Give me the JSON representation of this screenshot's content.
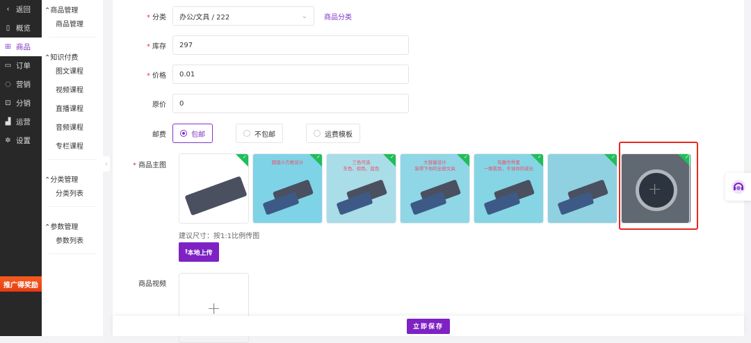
{
  "nav": [
    {
      "icon": "chevron-left-icon",
      "glyph": "‹",
      "label": "返回"
    },
    {
      "icon": "overview-icon",
      "glyph": "▯",
      "label": "概览"
    },
    {
      "icon": "gift-icon",
      "glyph": "⊞",
      "label": "商品"
    },
    {
      "icon": "folder-icon",
      "glyph": "▭",
      "label": "订单"
    },
    {
      "icon": "target-icon",
      "glyph": "◌",
      "label": "营销"
    },
    {
      "icon": "share-icon",
      "glyph": "⊡",
      "label": "分销"
    },
    {
      "icon": "bar-chart-icon",
      "glyph": "▟",
      "label": "运营"
    },
    {
      "icon": "gear-icon",
      "glyph": "✲",
      "label": "设置"
    }
  ],
  "promo": "推广得奖励",
  "submenu": [
    {
      "title": "商品管理",
      "items": [
        "商品管理"
      ]
    },
    {
      "title": "知识付费",
      "items": [
        "图文课程",
        "视频课程",
        "直播课程",
        "音频课程",
        "专栏课程"
      ]
    },
    {
      "title": "分类管理",
      "items": [
        "分类列表"
      ]
    },
    {
      "title": "参数管理",
      "items": [
        "参数列表"
      ]
    }
  ],
  "form": {
    "category": {
      "label": "分类",
      "value": "办公/文具 / 222",
      "link": "商品分类"
    },
    "stock": {
      "label": "库存",
      "value": "297"
    },
    "price": {
      "label": "价格",
      "value": "0.01"
    },
    "original_price": {
      "label": "原价",
      "value": "0"
    },
    "shipping": {
      "label": "邮费",
      "options": [
        "包邮",
        "不包邮",
        "运费模板"
      ],
      "selected": "包邮"
    },
    "main_image": {
      "label": "商品主图",
      "tip": "建议尺寸：按1:1比例传图",
      "upload": "本地上传",
      "captions": [
        "",
        "圆弧小方框设计",
        "三色可选\n灰色、棕色、蓝色",
        "大容量设计\n装得下你的全部文具",
        "有趣世界里\n一眼看到，不误你的成长",
        "",
        ""
      ]
    },
    "video": {
      "label": "商品视频"
    }
  },
  "footer": {
    "save": "立即保存"
  },
  "colors": {
    "accent": "#7e22c4",
    "highlight": "#e8261c"
  }
}
